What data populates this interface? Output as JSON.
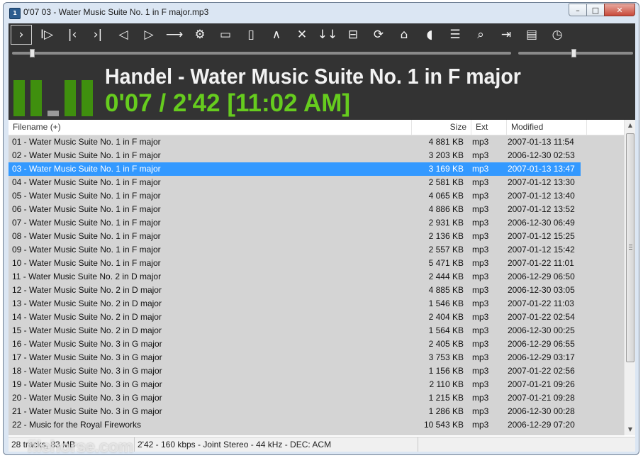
{
  "window": {
    "title": "0'07 03 - Water Music Suite No. 1 in F major.mp3",
    "app_icon_text": "1"
  },
  "winbtns": {
    "min": "–",
    "max": "□",
    "close": "✕"
  },
  "toolbar": [
    {
      "id": "play",
      "icon": "play-icon",
      "glyph": "›"
    },
    {
      "id": "pause",
      "icon": "pause-play-icon",
      "glyph": "I▷"
    },
    {
      "id": "prev",
      "icon": "previous-track-icon",
      "glyph": "|‹"
    },
    {
      "id": "next",
      "icon": "next-track-icon",
      "glyph": "›|"
    },
    {
      "id": "prevfolder",
      "icon": "previous-folder-icon",
      "glyph": "◁"
    },
    {
      "id": "nextfolder",
      "icon": "next-folder-icon",
      "glyph": "▷"
    },
    {
      "id": "goto",
      "icon": "jump-arrow-icon",
      "glyph": "⟶"
    },
    {
      "id": "settings",
      "icon": "gear-icon",
      "glyph": "⚙"
    },
    {
      "id": "window",
      "icon": "window-icon",
      "glyph": "▭"
    },
    {
      "id": "panel",
      "icon": "panel-icon",
      "glyph": "▯"
    },
    {
      "id": "up",
      "icon": "chevron-up-icon",
      "glyph": "∧"
    },
    {
      "id": "close",
      "icon": "close-icon",
      "glyph": "✕"
    },
    {
      "id": "sort",
      "icon": "sort-icon",
      "glyph": "↓↓"
    },
    {
      "id": "split",
      "icon": "split-view-icon",
      "glyph": "⊟"
    },
    {
      "id": "refresh",
      "icon": "refresh-icon",
      "glyph": "⟳"
    },
    {
      "id": "home",
      "icon": "home-icon",
      "glyph": "⌂"
    },
    {
      "id": "volume",
      "icon": "speaker-icon",
      "glyph": "◖"
    },
    {
      "id": "list",
      "icon": "list-cursor-icon",
      "glyph": "☰"
    },
    {
      "id": "search",
      "icon": "search-icon",
      "glyph": "⌕"
    },
    {
      "id": "remove",
      "icon": "remove-icon",
      "glyph": "⇥"
    },
    {
      "id": "info",
      "icon": "info-card-icon",
      "glyph": "▤"
    },
    {
      "id": "clock",
      "icon": "clock-icon",
      "glyph": "◷"
    }
  ],
  "player": {
    "seek_fraction": 0.04,
    "volume_fraction": 0.46,
    "meter_levels": [
      0.98,
      0.98,
      0.15,
      0.98,
      0.98
    ],
    "meter_color": "#3f8f0e",
    "track_title": "Handel - Water Music Suite No. 1 in F major",
    "time_display": "0'07 / 2'42   [11:02 AM]",
    "accent_color": "#66cc1e"
  },
  "columns": {
    "filename": "Filename (+)",
    "size": "Size",
    "ext": "Ext",
    "modified": "Modified"
  },
  "files": [
    {
      "name": "01 - Water Music Suite No. 1 in F major",
      "size": "4 881 KB",
      "ext": "mp3",
      "modified": "2007-01-13 11:54"
    },
    {
      "name": "02 - Water Music Suite No. 1 in F major",
      "size": "3 203 KB",
      "ext": "mp3",
      "modified": "2006-12-30 02:53"
    },
    {
      "name": "03 - Water Music Suite No. 1 in F major",
      "size": "3 169 KB",
      "ext": "mp3",
      "modified": "2007-01-13 13:47",
      "selected": true
    },
    {
      "name": "04 - Water Music Suite No. 1 in F major",
      "size": "2 581 KB",
      "ext": "mp3",
      "modified": "2007-01-12 13:30"
    },
    {
      "name": "05 - Water Music Suite No. 1 in F major",
      "size": "4 065 KB",
      "ext": "mp3",
      "modified": "2007-01-12 13:40"
    },
    {
      "name": "06 - Water Music Suite No. 1 in F major",
      "size": "4 886 KB",
      "ext": "mp3",
      "modified": "2007-01-12 13:52"
    },
    {
      "name": "07 - Water Music Suite No. 1 in F major",
      "size": "2 931 KB",
      "ext": "mp3",
      "modified": "2006-12-30 06:49"
    },
    {
      "name": "08 - Water Music Suite No. 1 in F major",
      "size": "2 136 KB",
      "ext": "mp3",
      "modified": "2007-01-12 15:25"
    },
    {
      "name": "09 - Water Music Suite No. 1 in F major",
      "size": "2 557 KB",
      "ext": "mp3",
      "modified": "2007-01-12 15:42"
    },
    {
      "name": "10 - Water Music Suite No. 1 in F major",
      "size": "5 471 KB",
      "ext": "mp3",
      "modified": "2007-01-22 11:01"
    },
    {
      "name": "11 - Water Music Suite No. 2 in D major",
      "size": "2 444 KB",
      "ext": "mp3",
      "modified": "2006-12-29 06:50"
    },
    {
      "name": "12 - Water Music Suite No. 2 in D major",
      "size": "4 885 KB",
      "ext": "mp3",
      "modified": "2006-12-30 03:05"
    },
    {
      "name": "13 - Water Music Suite No. 2 in D major",
      "size": "1 546 KB",
      "ext": "mp3",
      "modified": "2007-01-22 11:03"
    },
    {
      "name": "14 - Water Music Suite No. 2 in D major",
      "size": "2 404 KB",
      "ext": "mp3",
      "modified": "2007-01-22 02:54"
    },
    {
      "name": "15 - Water Music Suite No. 2 in D major",
      "size": "1 564 KB",
      "ext": "mp3",
      "modified": "2006-12-30 00:25"
    },
    {
      "name": "16 - Water Music Suite No. 3 in G major",
      "size": "2 405 KB",
      "ext": "mp3",
      "modified": "2006-12-29 06:55"
    },
    {
      "name": "17 - Water Music Suite No. 3 in G major",
      "size": "3 753 KB",
      "ext": "mp3",
      "modified": "2006-12-29 03:17"
    },
    {
      "name": "18 - Water Music Suite No. 3 in G major",
      "size": "1 156 KB",
      "ext": "mp3",
      "modified": "2007-01-22 02:56"
    },
    {
      "name": "19 - Water Music Suite No. 3 in G major",
      "size": "2 110 KB",
      "ext": "mp3",
      "modified": "2007-01-21 09:26"
    },
    {
      "name": "20 - Water Music Suite No. 3 in G major",
      "size": "1 215 KB",
      "ext": "mp3",
      "modified": "2007-01-21 09:28"
    },
    {
      "name": "21 - Water Music Suite No. 3 in G major",
      "size": "1 286 KB",
      "ext": "mp3",
      "modified": "2006-12-30 00:28"
    },
    {
      "name": "22 - Music for the Royal Fireworks",
      "size": "10 543 KB",
      "ext": "mp3",
      "modified": "2006-12-29 07:20"
    }
  ],
  "status": {
    "summary": "28 tracks, 83 MB",
    "info": "2'42 - 160 kbps - Joint Stereo - 44 kHz - DEC: ACM"
  },
  "watermark": "filehorse.com",
  "colors": {
    "selection": "#3399ff",
    "list_bg": "#d4d4d4",
    "player_bg": "#333333"
  }
}
